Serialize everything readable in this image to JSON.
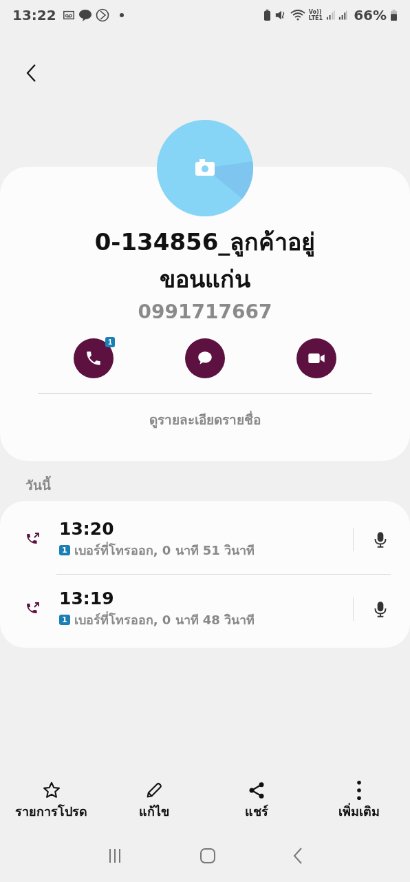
{
  "status_bar": {
    "time": "13:22",
    "volte": "Vo))",
    "network": "LTE1",
    "battery": "66%"
  },
  "contact": {
    "name": "0-134856_ลูกค้าอยู่ขอนแก่น",
    "phone": "0991717667"
  },
  "actions": [
    {
      "kind": "call",
      "badge": "1"
    },
    {
      "kind": "message"
    },
    {
      "kind": "video"
    }
  ],
  "details_link": "ดูรายละเอียดรายชื่อ",
  "section_label": "วันนี้",
  "calls": [
    {
      "time": "13:20",
      "sim": "1",
      "description": "เบอร์ที่โทรออก, 0 นาที 51 วินาที"
    },
    {
      "time": "13:19",
      "sim": "1",
      "description": "เบอร์ที่โทรออก, 0 นาที 48 วินาที"
    }
  ],
  "bottom_actions": [
    {
      "kind": "favorite",
      "label": "รายการโปรด"
    },
    {
      "kind": "edit",
      "label": "แก้ไข"
    },
    {
      "kind": "share",
      "label": "แชร์"
    },
    {
      "kind": "more",
      "label": "เพิ่มเติม"
    }
  ]
}
